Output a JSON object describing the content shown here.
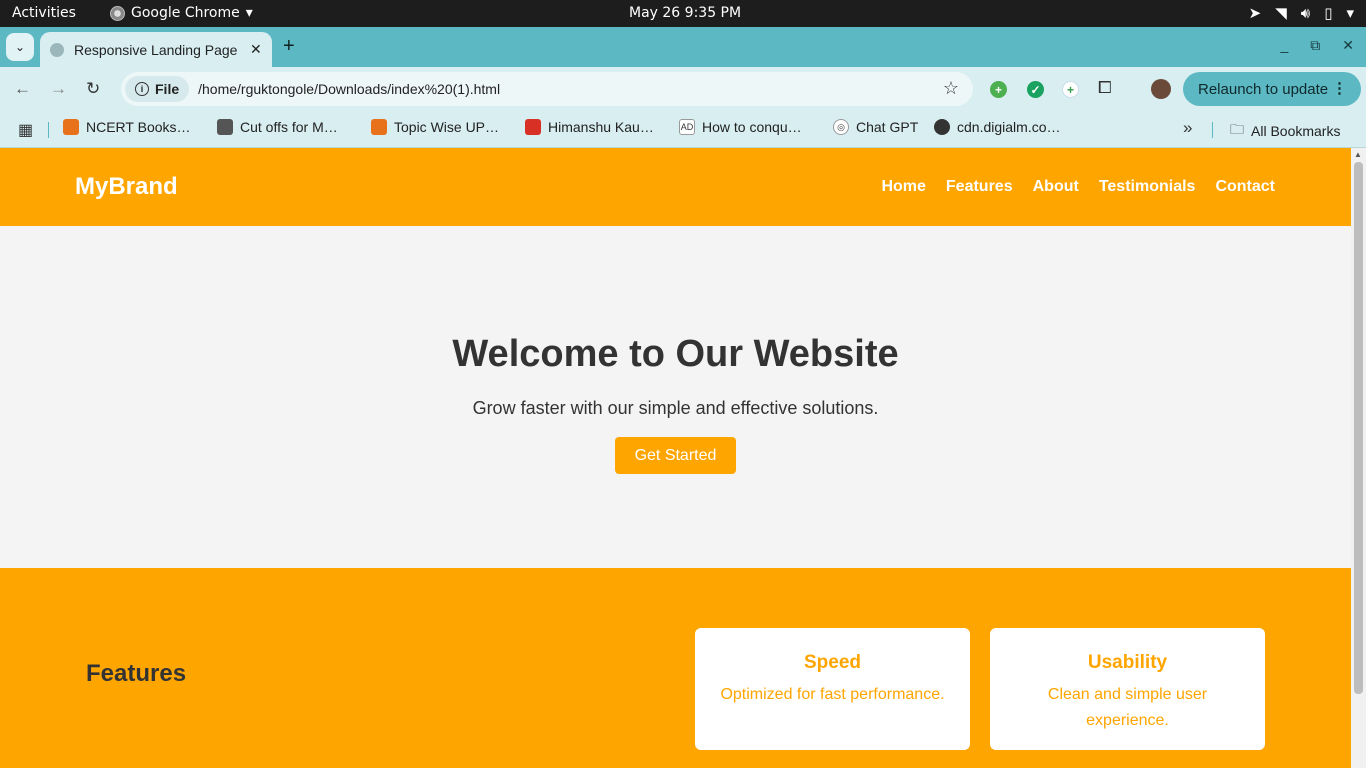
{
  "system_bar": {
    "activities": "Activities",
    "app_name": "Google Chrome",
    "app_caret": "▾",
    "clock": "May 26   9:35 PM"
  },
  "browser": {
    "tab_title": "Responsive Landing Page",
    "tab_close": "✕",
    "new_tab": "+",
    "address_chip": "File",
    "url": "/home/rguktongole/Downloads/index%20(1).html",
    "relaunch_label": "Relaunch to update",
    "bookmarks": [
      {
        "label": "NCERT Books…",
        "icon_color": "#e8711c"
      },
      {
        "label": "Cut offs for M…",
        "icon_color": "#555555"
      },
      {
        "label": "Topic Wise UP…",
        "icon_color": "#e8711c"
      },
      {
        "label": "Himanshu Kau…",
        "icon_color": "#d93025"
      },
      {
        "label": "How to conqu…",
        "icon_color": "#333333"
      },
      {
        "label": "Chat GPT",
        "icon_color": "#333333"
      },
      {
        "label": "cdn.digialm.co…",
        "icon_color": "#333333"
      }
    ],
    "all_bookmarks": "All Bookmarks"
  },
  "site": {
    "brand": "MyBrand",
    "nav": [
      "Home",
      "Features",
      "About",
      "Testimonials",
      "Contact"
    ],
    "hero": {
      "heading": "Welcome to Our Website",
      "subheading": "Grow faster with our simple and effective solutions.",
      "cta": "Get Started"
    },
    "features": {
      "heading": "Features",
      "cards": [
        {
          "title": "Speed",
          "text": "Optimized for fast performance."
        },
        {
          "title": "Usability",
          "text": "Clean and simple user experience."
        }
      ]
    }
  },
  "colors": {
    "accent": "#ffa500",
    "chrome_frame": "#5cb8c2",
    "chrome_toolbar": "#d8eef1"
  }
}
